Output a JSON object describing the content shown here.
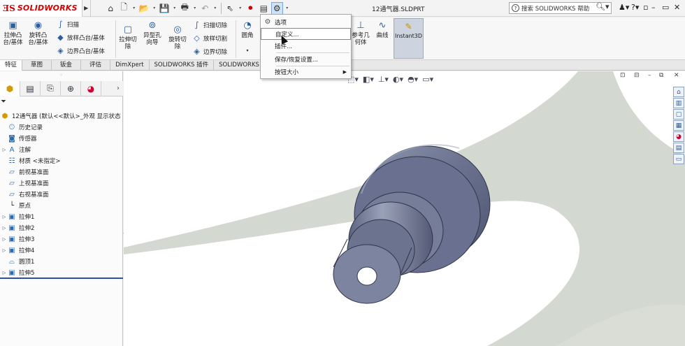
{
  "app": {
    "brand": "SOLIDWORKS",
    "file_title": "12通气器.SLDPRT",
    "help_search_placeholder": "搜索 SOLIDWORKS 帮助"
  },
  "colors": {
    "brand_red": "#d40000",
    "model_body": "#6f7794",
    "model_edge": "#3a3f57",
    "background_swoosh": "#d3d8d0",
    "rollback_bar": "#2d4fa8",
    "highlight_cursor": "#ffee00"
  },
  "ribbon": {
    "extrude_boss": "拉伸凸台/基体",
    "revolve_boss": "旋转凸台/基体",
    "sweep": "扫描",
    "loft_boss": "放样凸台/基体",
    "boundary_boss": "边界凸台/基体",
    "extrude_cut": "拉伸切除",
    "hole_wizard": "异型孔向导",
    "revolve_cut": "旋转切除",
    "sweep_cut": "扫描切除",
    "loft_cut": "放样切割",
    "boundary_cut": "边界切除",
    "fillet": "圆角",
    "reference_geometry": "参考几何体",
    "curves": "曲线",
    "instant3d": "Instant3D"
  },
  "tabs": [
    "特征",
    "草图",
    "钣金",
    "评估",
    "DimXpert",
    "SOLIDWORKS 插件",
    "SOLIDWORKS MBD"
  ],
  "options_menu": {
    "items": [
      "选项",
      "自定义...",
      "插件...",
      "保存/恢复设置...",
      "按钮大小"
    ]
  },
  "tree": {
    "root": "12通气器 (默认<<默认>_外观 显示状态",
    "items": [
      "历史记录",
      "传感器",
      "注解",
      "材质 <未指定>",
      "前视基准面",
      "上视基准面",
      "右视基准面",
      "原点",
      "拉伸1",
      "拉伸2",
      "拉伸3",
      "拉伸4",
      "圆顶1",
      "拉伸5"
    ]
  }
}
